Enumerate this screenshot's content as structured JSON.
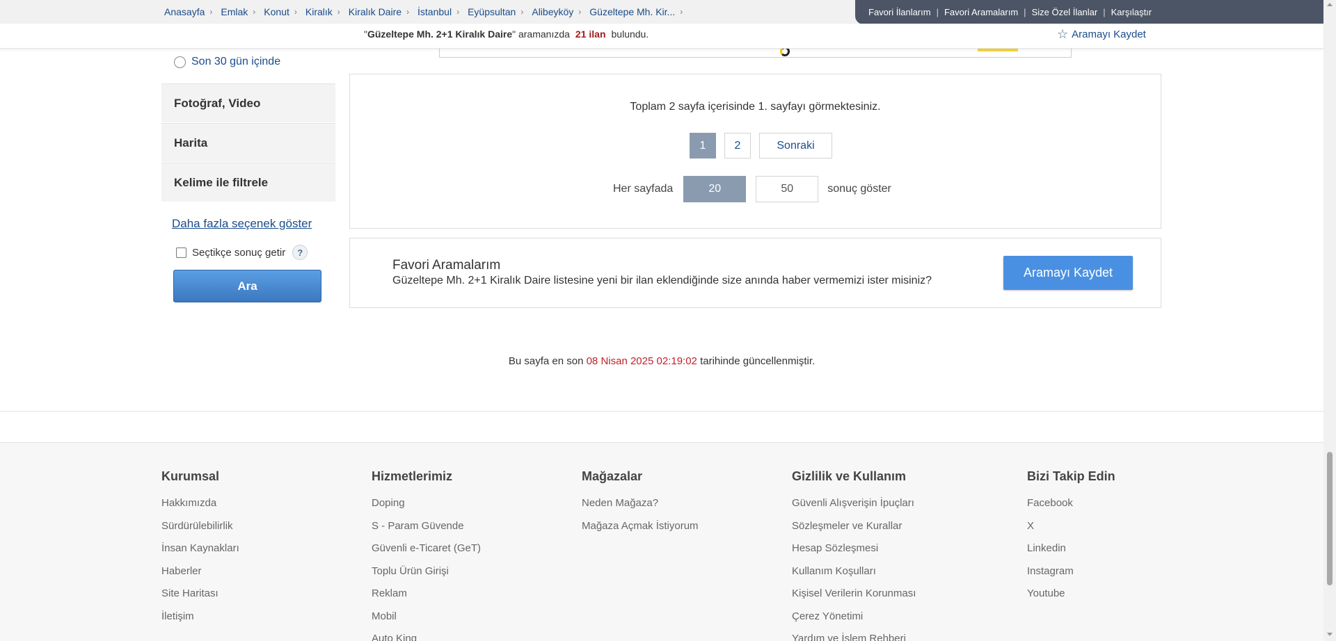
{
  "breadcrumb": [
    "Anasayfa",
    "Emlak",
    "Konut",
    "Kiralık",
    "Kiralık Daire",
    "İstanbul",
    "Eyüpsultan",
    "Alibeyköy",
    "Güzeltepe Mh. Kir..."
  ],
  "quick_links": [
    "Favori İlanlarım",
    "Favori Aramalarım",
    "Size Özel İlanlar",
    "Karşılaştır"
  ],
  "result_info": {
    "query": "Güzeltepe Mh. 2+1 Kiralık Daire",
    "pre": "\"",
    "post": "\" aramanızda",
    "count": "21 ilan",
    "suffix": "bulundu.",
    "save_search": "Aramayı Kaydet"
  },
  "sidebar": {
    "date_option": "Son 30 gün içinde",
    "sections": [
      "Fotoğraf, Video",
      "Harita",
      "Kelime ile filtrele"
    ],
    "more_options": "Daha fazla seçenek göster",
    "instant_results": "Seçtikçe sonuç getir",
    "help": "?",
    "search_button": "Ara"
  },
  "pagination": {
    "summary": "Toplam 2 sayfa içerisinde 1. sayfayı görmektesiniz.",
    "pages": [
      "1",
      "2"
    ],
    "next": "Sonraki",
    "current_page": "1",
    "per_page_label": "Her sayfada",
    "per_page_options": [
      "20",
      "50"
    ],
    "per_page_selected": "20",
    "per_page_suffix": "sonuç göster"
  },
  "favorite_search": {
    "title": "Favori Aramalarım",
    "description": "Güzeltepe Mh. 2+1 Kiralık Daire listesine yeni bir ilan eklendiğinde size anında haber vermemizi ister misiniz?",
    "button": "Aramayı Kaydet"
  },
  "updated": {
    "prefix": "Bu sayfa en son",
    "date": "08 Nisan 2025 02:19:02",
    "suffix": "tarihinde güncellenmiştir."
  },
  "footer": {
    "columns": [
      {
        "title": "Kurumsal",
        "links": [
          "Hakkımızda",
          "Sürdürülebilirlik",
          "İnsan Kaynakları",
          "Haberler",
          "Site Haritası",
          "İletişim"
        ]
      },
      {
        "title": "Hizmetlerimiz",
        "links": [
          "Doping",
          "S - Param Güvende",
          "Güvenli e-Ticaret (GeT)",
          "Toplu Ürün Girişi",
          "Reklam",
          "Mobil",
          "Auto King"
        ]
      },
      {
        "title": "Mağazalar",
        "links": [
          "Neden Mağaza?",
          "Mağaza Açmak İstiyorum"
        ]
      },
      {
        "title": "Gizlilik ve Kullanım",
        "links": [
          "Güvenli Alışverişin İpuçları",
          "Sözleşmeler ve Kurallar",
          "Hesap Sözleşmesi",
          "Kullanım Koşulları",
          "Kişisel Verilerin Korunması",
          "Çerez Yönetimi",
          "Yardım ve İşlem Rehberi"
        ]
      },
      {
        "title": "Bizi Takip Edin",
        "links": [
          "Facebook",
          "X",
          "Linkedin",
          "Instagram",
          "Youtube"
        ]
      }
    ]
  },
  "colors": {
    "link_blue": "#1a4c8b",
    "accent_blue": "#4a90e2",
    "active_page": "#8a9bb0",
    "highlight_red": "#c0212a",
    "quicklinks_bg": "#4b5566"
  },
  "icons": {
    "save_search": "star-outline-icon",
    "breadcrumb_separator": "chevron-right-icon",
    "help": "question-circle-icon"
  }
}
